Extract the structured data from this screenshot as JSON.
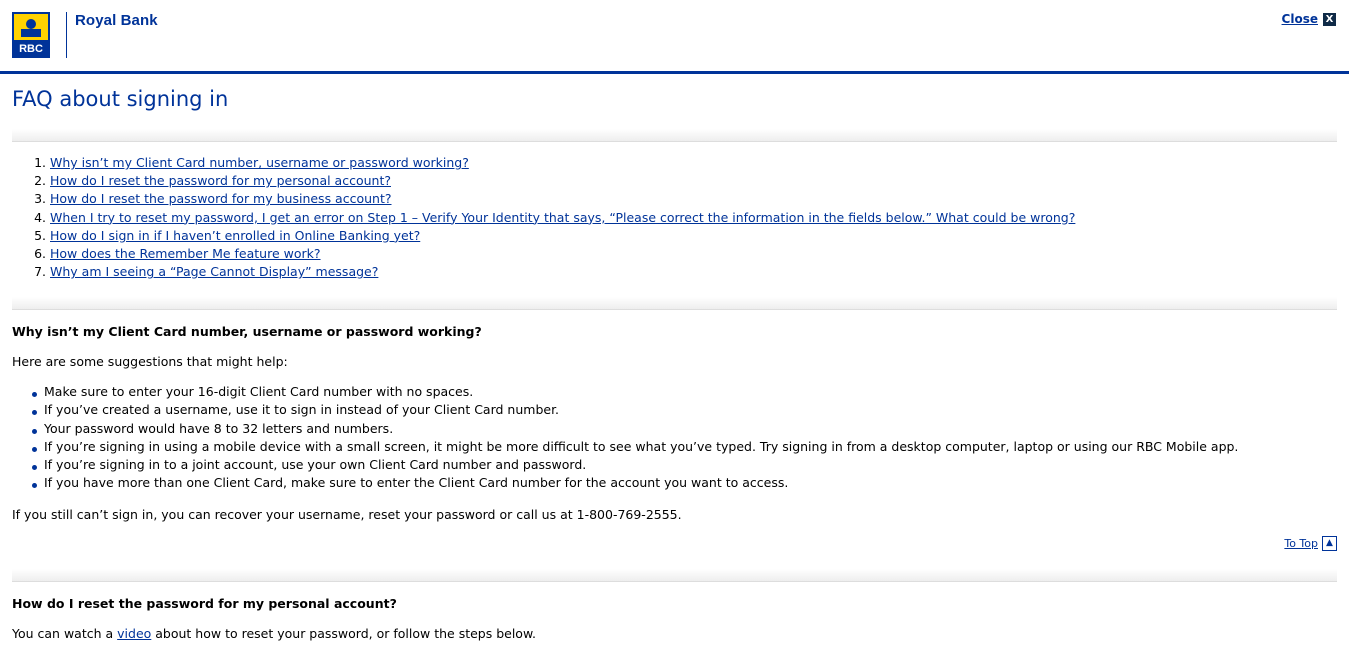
{
  "header": {
    "logo_text": "Royal Bank",
    "logo_shield_text": "RBC",
    "close_label": "Close",
    "close_icon_glyph": "X"
  },
  "page": {
    "title": "FAQ about signing in"
  },
  "toc": {
    "items": [
      "Why isn’t my Client Card number, username or password working?",
      "How do I reset the password for my personal account?",
      "How do I reset the password for my business account?",
      "When I try to reset my password, I get an error on Step 1 – Verify Your Identity that says, “Please correct the information in the fields below.” What could be wrong?",
      "How do I sign in if I haven’t enrolled in Online Banking yet?",
      "How does the Remember Me feature work?",
      "Why am I seeing a “Page Cannot Display” message?"
    ]
  },
  "section1": {
    "heading": "Why isn’t my Client Card number, username or password working?",
    "intro": "Here are some suggestions that might help:",
    "bullets": [
      "Make sure to enter your 16-digit Client Card number with no spaces.",
      "If you’ve created a username, use it to sign in instead of your Client Card number.",
      "Your password would have 8 to 32 letters and numbers.",
      "If you’re signing in using a mobile device with a small screen, it might be more difficult to see what you’ve typed. Try signing in from a desktop computer, laptop or using our RBC Mobile app.",
      "If you’re signing in to a joint account, use your own Client Card number and password.",
      "If you have more than one Client Card, make sure to enter the Client Card number for the account you want to access."
    ],
    "closing": "If you still can’t sign in, you can recover your username, reset your password or call us at 1-800-769-2555.",
    "to_top_label": "To Top"
  },
  "section2": {
    "heading": "How do I reset the password for my personal account?",
    "text_before": "You can watch a ",
    "link_text": "video",
    "text_after": " about how to reset your password, or follow the steps below."
  },
  "colors": {
    "brand_blue": "#003399",
    "close_icon_bg": "#0f2a47"
  }
}
